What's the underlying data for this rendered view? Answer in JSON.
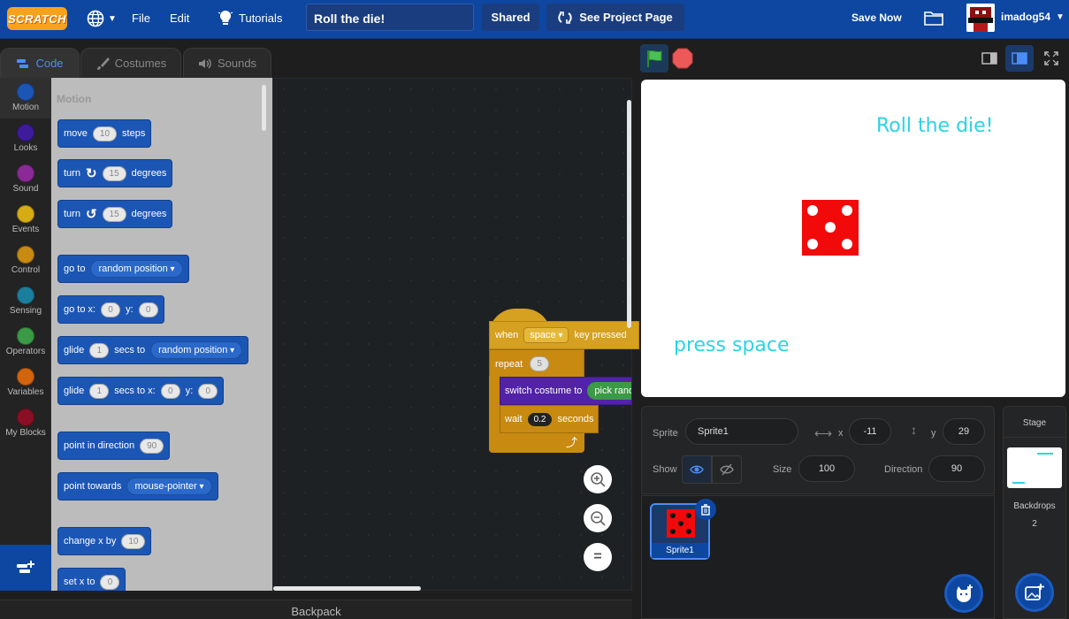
{
  "menu": {
    "logo": "SCRATCH",
    "file": "File",
    "edit": "Edit",
    "tutorials": "Tutorials",
    "project_title": "Roll the die!",
    "shared": "Shared",
    "see_project_page": "See Project Page",
    "save_now": "Save Now",
    "username": "imadog54"
  },
  "tabs": {
    "code": "Code",
    "costumes": "Costumes",
    "sounds": "Sounds"
  },
  "categories": [
    {
      "label": "Motion",
      "color": "#1c56b5"
    },
    {
      "label": "Looks",
      "color": "#3d1b9a"
    },
    {
      "label": "Sound",
      "color": "#8b2a96"
    },
    {
      "label": "Events",
      "color": "#d6ac14"
    },
    {
      "label": "Control",
      "color": "#c88a10"
    },
    {
      "label": "Sensing",
      "color": "#1b7e9c"
    },
    {
      "label": "Operators",
      "color": "#3a9a45"
    },
    {
      "label": "Variables",
      "color": "#d2640c"
    },
    {
      "label": "My Blocks",
      "color": "#8a0f24"
    }
  ],
  "palette": {
    "heading": "Motion",
    "move": {
      "a": "move",
      "v": "10",
      "b": "steps"
    },
    "turn_right": {
      "a": "turn",
      "v": "15",
      "b": "degrees"
    },
    "turn_left": {
      "a": "turn",
      "v": "15",
      "b": "degrees"
    },
    "goto": {
      "a": "go to",
      "d": "random position"
    },
    "gotoxy": {
      "a": "go to x:",
      "x": "0",
      "b": "y:",
      "y": "0"
    },
    "glide": {
      "a": "glide",
      "v": "1",
      "b": "secs to",
      "d": "random position"
    },
    "glidexy": {
      "a": "glide",
      "v": "1",
      "b": "secs to x:",
      "x": "0",
      "c": "y:",
      "y": "0"
    },
    "point_dir": {
      "a": "point in direction",
      "v": "90"
    },
    "point_towards": {
      "a": "point towards",
      "d": "mouse-pointer"
    },
    "change_x": {
      "a": "change x by",
      "v": "10"
    },
    "set_x": {
      "a": "set x to",
      "v": "0"
    }
  },
  "script": {
    "when": "when",
    "key": "space",
    "pressed": "key pressed",
    "repeat": "repeat",
    "repeat_n": "5",
    "switch": "switch costume to",
    "pick": "pick rand",
    "wait": "wait",
    "wait_v": "0.2",
    "seconds": "seconds"
  },
  "stage": {
    "title_text": "Roll the die!",
    "hint_text": "press space"
  },
  "sprite_info": {
    "sprite_label": "Sprite",
    "sprite_name": "Sprite1",
    "x_label": "x",
    "x": "-11",
    "y_label": "y",
    "y": "29",
    "show_label": "Show",
    "size_label": "Size",
    "size": "100",
    "direction_label": "Direction",
    "direction": "90"
  },
  "sprite_list": {
    "item": "Sprite1"
  },
  "stage_panel": {
    "title": "Stage",
    "backdrops_label": "Backdrops",
    "backdrops_count": "2"
  },
  "backpack": "Backpack"
}
